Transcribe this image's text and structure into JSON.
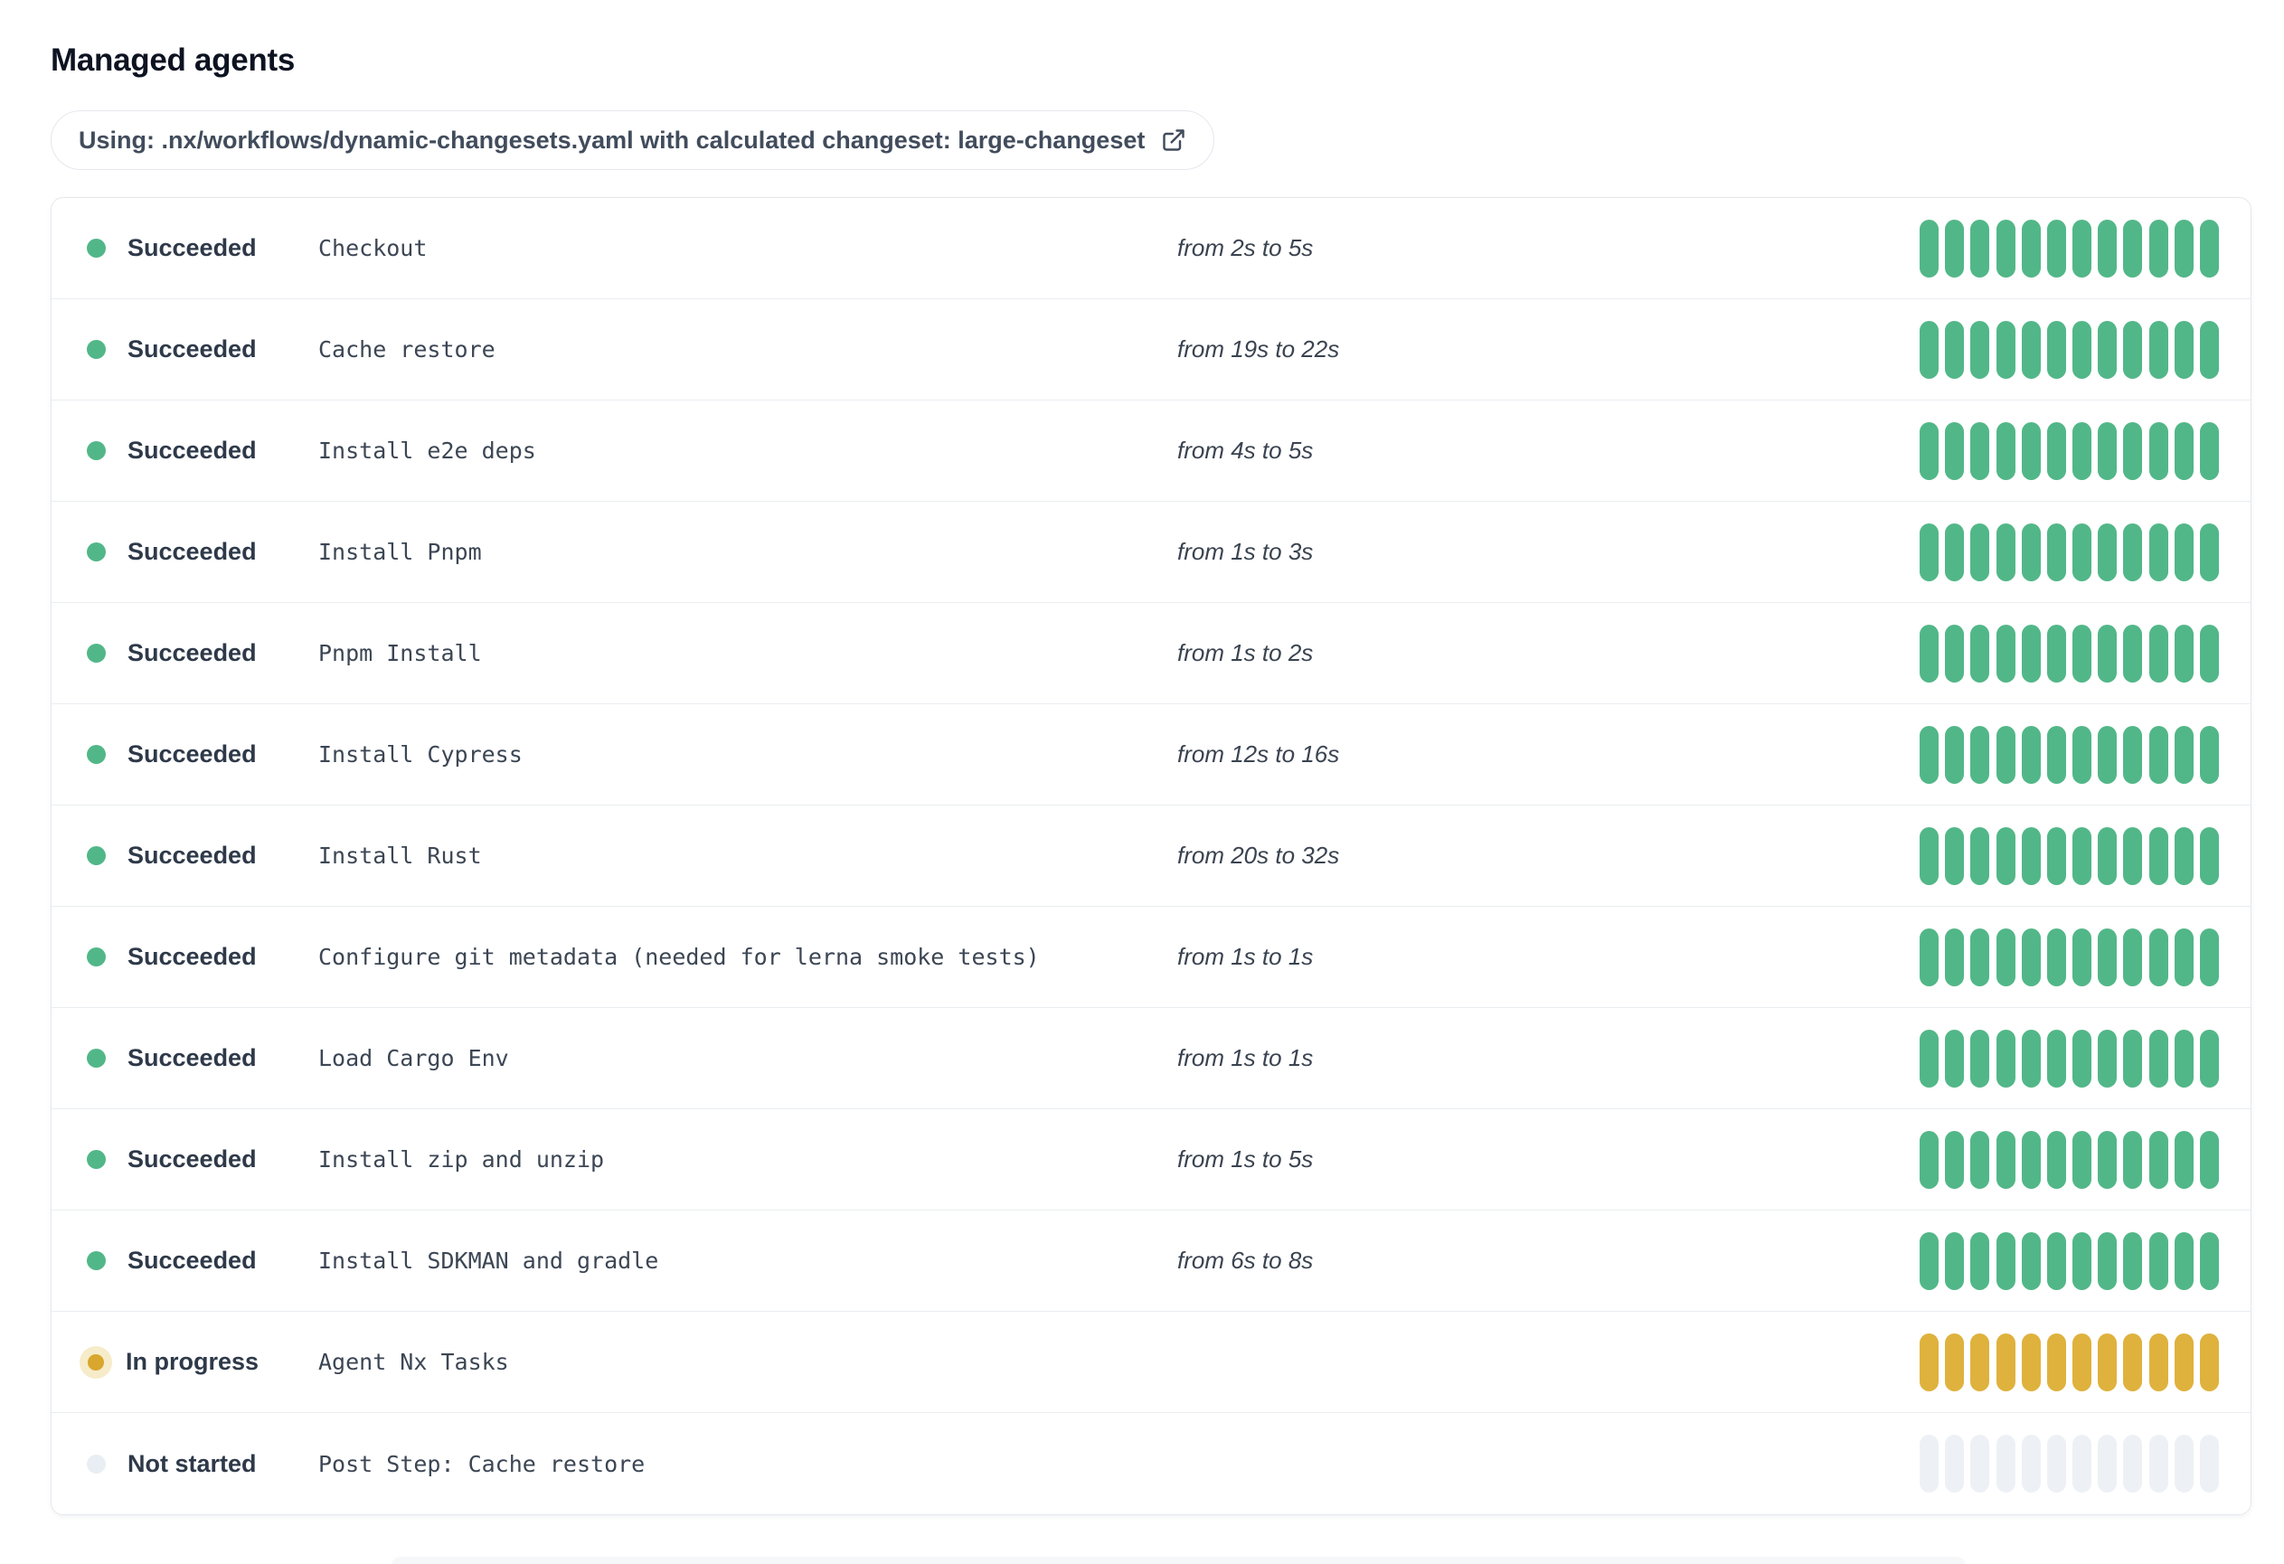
{
  "page": {
    "title": "Managed agents"
  },
  "workflow_banner": {
    "text": "Using: .nx/workflows/dynamic-changesets.yaml with calculated changeset: large-changeset",
    "icon": "external-link-icon"
  },
  "colors": {
    "green": "#52B788",
    "amber": "#DFB23D",
    "amber-dot": "#D9A62E",
    "amber-halo": "#F6ECC9",
    "gray-bar": "#EDF1F6",
    "gray-dot": "#E9EEF4",
    "text-dark": "#2E3949",
    "title": "#0D1321",
    "border": "#E4E8EE"
  },
  "agents": {
    "bar_count": 12,
    "rows": [
      {
        "status": "succeeded",
        "status_label": "Succeeded",
        "step": "Checkout",
        "duration": "from 2s to 5s"
      },
      {
        "status": "succeeded",
        "status_label": "Succeeded",
        "step": "Cache restore",
        "duration": "from 19s to 22s"
      },
      {
        "status": "succeeded",
        "status_label": "Succeeded",
        "step": "Install e2e deps",
        "duration": "from 4s to 5s"
      },
      {
        "status": "succeeded",
        "status_label": "Succeeded",
        "step": "Install Pnpm",
        "duration": "from 1s to 3s"
      },
      {
        "status": "succeeded",
        "status_label": "Succeeded",
        "step": "Pnpm Install",
        "duration": "from 1s to 2s"
      },
      {
        "status": "succeeded",
        "status_label": "Succeeded",
        "step": "Install Cypress",
        "duration": "from 12s to 16s"
      },
      {
        "status": "succeeded",
        "status_label": "Succeeded",
        "step": "Install Rust",
        "duration": "from 20s to 32s"
      },
      {
        "status": "succeeded",
        "status_label": "Succeeded",
        "step": "Configure git metadata (needed for lerna smoke tests)",
        "duration": "from 1s to 1s"
      },
      {
        "status": "succeeded",
        "status_label": "Succeeded",
        "step": "Load Cargo Env",
        "duration": "from 1s to 1s"
      },
      {
        "status": "succeeded",
        "status_label": "Succeeded",
        "step": "Install zip and unzip",
        "duration": "from 1s to 5s"
      },
      {
        "status": "succeeded",
        "status_label": "Succeeded",
        "step": "Install SDKMAN and gradle",
        "duration": "from 6s to 8s"
      },
      {
        "status": "in-progress",
        "status_label": "In progress",
        "step": "Agent Nx Tasks",
        "duration": ""
      },
      {
        "status": "not-started",
        "status_label": "Not started",
        "step": "Post Step: Cache restore",
        "duration": ""
      }
    ]
  }
}
